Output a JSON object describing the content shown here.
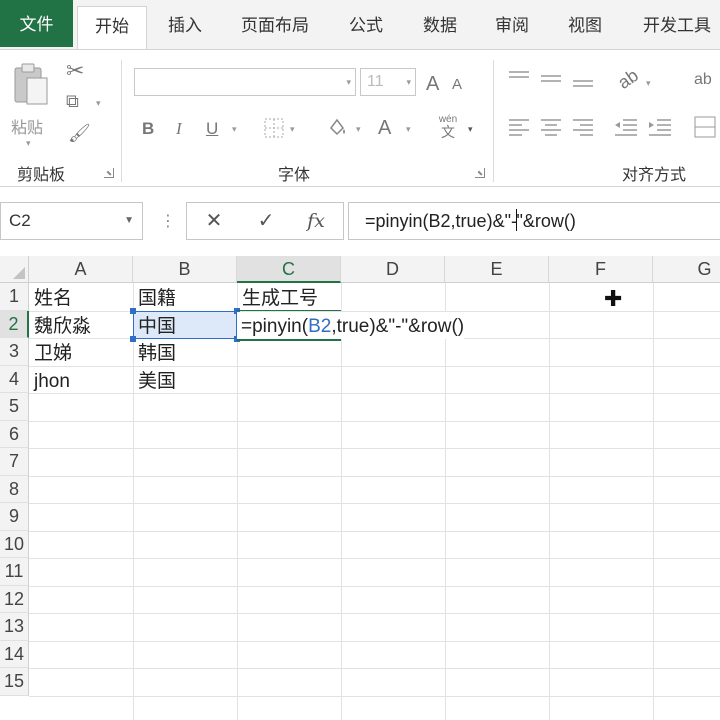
{
  "ribbon_tabs": {
    "file": "文件",
    "home": "开始",
    "insert": "插入",
    "page_layout": "页面布局",
    "formulas": "公式",
    "data": "数据",
    "review": "审阅",
    "view": "视图",
    "developer": "开发工具"
  },
  "ribbon": {
    "clipboard": {
      "paste_label": "粘贴",
      "group_label": "剪贴板"
    },
    "font": {
      "font_name_value": "",
      "font_size_value": "11",
      "bold": "B",
      "italic": "I",
      "underline": "U",
      "grow_font": "A",
      "shrink_font": "A",
      "font_color": "A",
      "phonetic_top": "wén",
      "phonetic_bottom": "文",
      "group_label": "字体"
    },
    "alignment": {
      "wrap_label": "ab",
      "group_label": "对齐方式"
    }
  },
  "formula_bar": {
    "name_box": "C2",
    "cancel_glyph": "✕",
    "enter_glyph": "✓",
    "fx_label": "fx",
    "formula_before_cursor": "=pinyin(B2,true)&\"-",
    "formula_after_cursor": "\"&row()"
  },
  "grid": {
    "columns": [
      "A",
      "B",
      "C",
      "D",
      "E",
      "F",
      "G"
    ],
    "rows": [
      "1",
      "2",
      "3",
      "4",
      "5",
      "6",
      "7",
      "8",
      "9",
      "10",
      "11",
      "12",
      "13",
      "14",
      "15"
    ],
    "selected_column": "C",
    "selected_row": "2",
    "cells": {
      "A1": "姓名",
      "B1": "国籍",
      "C1": "生成工号",
      "A2": "魏欣淼",
      "B2": "中国",
      "A3": "卫娣",
      "B3": "韩国",
      "A4": "jhon",
      "B4": "美国"
    },
    "editing": {
      "cell": "C2",
      "prefix": "=pinyin(",
      "ref": "B2",
      "suffix": ",true)&\"-\"&row()"
    }
  },
  "colors": {
    "accent": "#217346",
    "reference_highlight": "#2f6ec4"
  }
}
